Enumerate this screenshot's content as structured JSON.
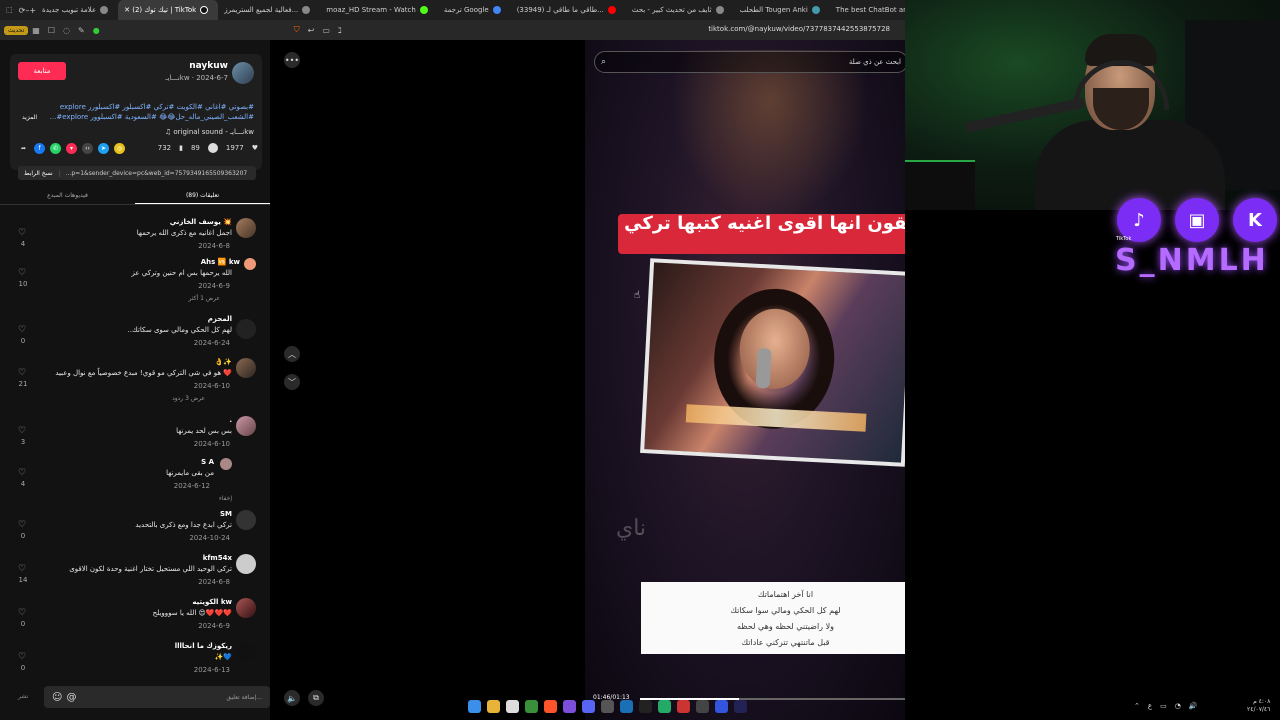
{
  "browser": {
    "tabs": [
      {
        "label": "علامة تبويب جديدة"
      },
      {
        "label": "(2) تيك توك | TikTok",
        "active": true
      },
      {
        "label": "فعالية لجميع الستريمرز..."
      },
      {
        "label": "moaz_HD Stream - Watch"
      },
      {
        "label": "ترجمة Google"
      },
      {
        "label": "(33949) طاقي ما طاقي لـ..."
      },
      {
        "label": "ثايف من تحديث كبير - بحث"
      },
      {
        "label": "الطحلب Tougen Anki"
      },
      {
        "label": "The best ChatBot and W..."
      }
    ],
    "update_label": "تحديث",
    "url": "tiktok.com/@naykuw/video/7377837442553875728"
  },
  "video_info": {
    "follow_label": "متابعة",
    "author_name": "naykuw",
    "author_sub": "نـــايـkw · 2024-6-7",
    "description": "#بصوتي #اغاني #الكويت #تركي #اكسبلور #اكسبلورر explore #الشعب_الصيني_ماله_حل😂😂 #السعودية #اكسبلوور explore#...",
    "more_label": "المزيد",
    "sound": "♫ original sound - نـــايـkw",
    "likes": "1977",
    "comments_count": "89",
    "saves": "732",
    "link": "...p=1&sender_device=pc&web_id=7579349165509363207",
    "copy_label": "نسخ الرابط",
    "tab_comments": "تعليقات (89)",
    "tab_creator_videos": "فيديوهات المبدع"
  },
  "comments": [
    {
      "name": "يوسف الخازني 💥",
      "text": "اجمل اغانيه مع ذكرى الله يرحمها",
      "date": "2024-6-8",
      "likes": "4",
      "replies": ""
    },
    {
      "name": "Ahs 🆚 kw",
      "text": "الله يرحمها بس ام حنين وتركي عز",
      "date": "2024-6-9",
      "likes": "10",
      "replies": "عرض 1 أكثر"
    },
    {
      "name": "المحزم",
      "text": "لهم كل الحكي ومالي سوى سكاتك..",
      "date": "2024-6-24",
      "likes": "0",
      "replies": ""
    },
    {
      "name": "👌✨",
      "text": "❤️ هو في شي التركي مو قوي! مبدع خصوصياً مع نوال وعبيد",
      "date": "2024-6-10",
      "likes": "21",
      "replies": "عرض 3 ردود"
    },
    {
      "name": ".",
      "text": "بس بس لحد يمرنها",
      "date": "2024-6-10",
      "likes": "3",
      "replies": ""
    },
    {
      "name": "S A",
      "text": "من بقى مايمرنها",
      "date": "2024-6-12",
      "likes": "4",
      "replies": "إخفاء"
    },
    {
      "name": "SM",
      "text": "تركي ابدع جدا ومع ذكرى بالتحديد",
      "date": "2024-10-24",
      "likes": "0",
      "replies": ""
    },
    {
      "name": "kfm54x",
      "text": "تركي الوحيد اللي مستحيل تختار اغنية وحدة لكون الاقوى",
      "date": "2024-6-8",
      "likes": "14",
      "replies": ""
    },
    {
      "name": "الكويتيه kw",
      "text": "❤️❤️❤️😍 الله يا سووويلح",
      "date": "2024-6-9",
      "likes": "0",
      "replies": ""
    },
    {
      "name": "ريكوزك ما انحاااا",
      "text": "💙✨",
      "date": "2024-6-13",
      "likes": "0",
      "replies": ""
    }
  ],
  "comment_input": {
    "placeholder": "إضافة تعليق...",
    "post_label": "نشر"
  },
  "video": {
    "search_placeholder": "ابحث عن ذي صلة",
    "banner_text": "تتفقون انها اقوى اغنيه كتبها تركي ؟",
    "lyrics": [
      "انا آخر اهتماماتك",
      "لهم كل الحكي ومالي سوا سكاتك",
      "ولا راضيتني لحظه وهي لحظه",
      "قبل ماتنتهي تتركني عاداتك"
    ],
    "timecode": "01:46/01:13",
    "progress_percent": 31
  },
  "stream_overlay": {
    "social_labels": [
      "TikTok"
    ],
    "brand": "S_NMLH"
  },
  "taskbar": {
    "clock_time": "٤:٠٨ م",
    "clock_date": "٢٤/٠٧/٤٦",
    "lang": "ع"
  }
}
